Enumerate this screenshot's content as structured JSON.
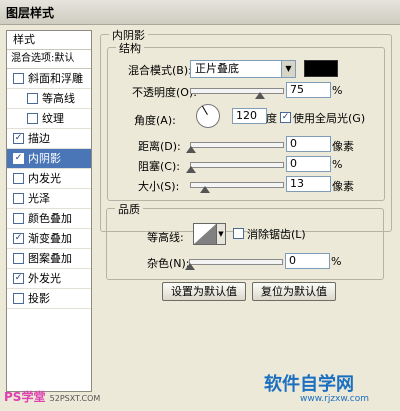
{
  "window": {
    "title": "图层样式"
  },
  "sidebar": {
    "header": "样式",
    "blend_options": "混合选项:默认",
    "items": [
      {
        "label": "斜面和浮雕",
        "checked": false
      },
      {
        "label": "等高线",
        "checked": false
      },
      {
        "label": "纹理",
        "checked": false
      },
      {
        "label": "描边",
        "checked": true
      },
      {
        "label": "内阴影",
        "checked": true
      },
      {
        "label": "内发光",
        "checked": false
      },
      {
        "label": "光泽",
        "checked": false
      },
      {
        "label": "颜色叠加",
        "checked": false
      },
      {
        "label": "渐变叠加",
        "checked": true
      },
      {
        "label": "图案叠加",
        "checked": false
      },
      {
        "label": "外发光",
        "checked": true
      },
      {
        "label": "投影",
        "checked": false
      }
    ],
    "check_mark": "✓"
  },
  "panel": {
    "title": "内阴影",
    "structure": {
      "title": "结构",
      "blend_mode_label": "混合模式(B):",
      "blend_mode_value": "正片叠底",
      "swatch_color": "#000000",
      "opacity_label": "不透明度(O):",
      "opacity_value": "75",
      "opacity_fraction": 0.75,
      "percent": "%",
      "angle_label": "角度(A):",
      "angle_value": "120",
      "angle_unit": "度",
      "global_light_label": "使用全局光(G)",
      "global_light_checked": true,
      "distance_label": "距离(D):",
      "distance_value": "0",
      "choke_label": "阻塞(C):",
      "choke_value": "0",
      "size_label": "大小(S):",
      "size_value": "13",
      "size_fraction": 0.052,
      "px_unit": "像素"
    },
    "quality": {
      "title": "品质",
      "contour_label": "等高线:",
      "anti_alias_label": "消除锯齿(L)",
      "anti_alias_checked": false,
      "noise_label": "杂色(N):",
      "noise_value": "0",
      "percent": "%"
    },
    "buttons": {
      "set_default": "设置为默认值",
      "reset_default": "复位为默认值"
    }
  },
  "watermarks": {
    "left": "PS学堂",
    "left_url": "52PSXT.COM",
    "right": "软件自学网",
    "right_url": "www.rjzxw.com"
  }
}
